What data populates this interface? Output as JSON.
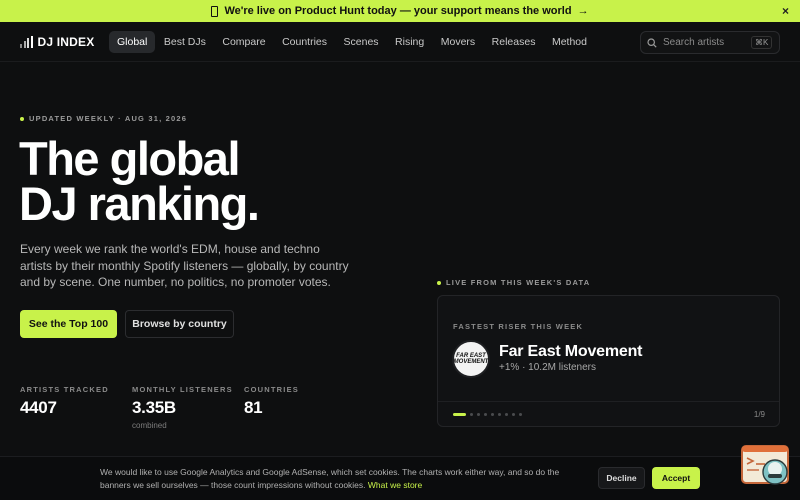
{
  "promo": {
    "text": "We're live on Product Hunt today — your support means the world",
    "arrow": "→",
    "close": "×"
  },
  "nav": {
    "logo": "DJ INDEX",
    "links": [
      "Global",
      "Best DJs",
      "Compare",
      "Countries",
      "Scenes",
      "Rising",
      "Movers",
      "Releases",
      "Method"
    ],
    "search_placeholder": "Search artists",
    "search_shortcut": "⌘K"
  },
  "hero": {
    "eyebrow": "UPDATED WEEKLY · AUG 31, 2026",
    "headline_line1": "The global",
    "headline_line2": "DJ ranking.",
    "lede": "Every week we rank the world's EDM, house and techno artists by their monthly Spotify listeners — globally, by country and by scene. One number, no politics, no promoter votes.",
    "primary_cta": "See the Top 100",
    "secondary_cta": "Browse by country"
  },
  "stats": [
    {
      "label": "ARTISTS TRACKED",
      "value": "4407",
      "sub": ""
    },
    {
      "label": "MONTHLY LISTENERS",
      "value": "3.35B",
      "sub": "combined"
    },
    {
      "label": "COUNTRIES",
      "value": "81",
      "sub": ""
    }
  ],
  "live": {
    "label": "LIVE FROM THIS WEEK'S DATA",
    "card_eyebrow": "FASTEST RISER THIS WEEK",
    "artist_logo_text": "FAR EAST MOVEMENT",
    "artist_name": "Far East Movement",
    "artist_meta": "+1% · 10.2M listeners",
    "page_count": "1/9",
    "page_total": 9,
    "page_current": 1
  },
  "cookie": {
    "text": "We would like to use Google Analytics and Google AdSense, which set cookies. The charts work either way, and so do the banners we sell ourselves — those count impressions without cookies.",
    "link": "What we store",
    "decline": "Decline",
    "accept": "Accept"
  },
  "colors": {
    "accent": "#c8f24a",
    "background": "#0e0f10",
    "card": "#111214"
  }
}
